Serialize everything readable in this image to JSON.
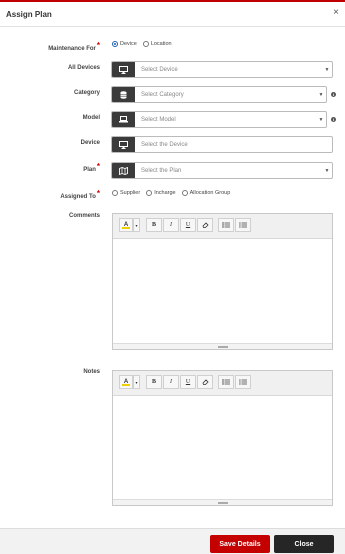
{
  "dialog": {
    "title": "Assign Plan",
    "close_glyph": "×"
  },
  "form": {
    "maintenance_for": {
      "label": "Maintenance For",
      "options": [
        "Device",
        "Location"
      ],
      "selected": "Device"
    },
    "all_devices": {
      "label": "All Devices",
      "placeholder": "Select Device",
      "icon": "monitor-icon"
    },
    "category": {
      "label": "Category",
      "placeholder": "Select Category",
      "icon": "database-icon"
    },
    "model": {
      "label": "Model",
      "placeholder": "Select Model",
      "icon": "laptop-icon"
    },
    "device": {
      "label": "Device",
      "placeholder": "Select the Device",
      "icon": "monitor-icon"
    },
    "plan": {
      "label": "Plan",
      "placeholder": "Select the Plan",
      "icon": "map-icon"
    },
    "assigned_to": {
      "label": "Assigned To",
      "options": [
        "Supplier",
        "Incharge",
        "Allocation Group"
      ]
    },
    "comments": {
      "label": "Comments"
    },
    "notes": {
      "label": "Notes"
    }
  },
  "editor_toolbar": {
    "font_color": "A",
    "dropdown": "▾",
    "bold": "B",
    "italic": "I",
    "underline": "U"
  },
  "footer": {
    "save_label": "Save Details",
    "close_label": "Close"
  },
  "colors": {
    "accent": "#c40000",
    "addon": "#3b3b3b",
    "close_button": "#262626"
  }
}
